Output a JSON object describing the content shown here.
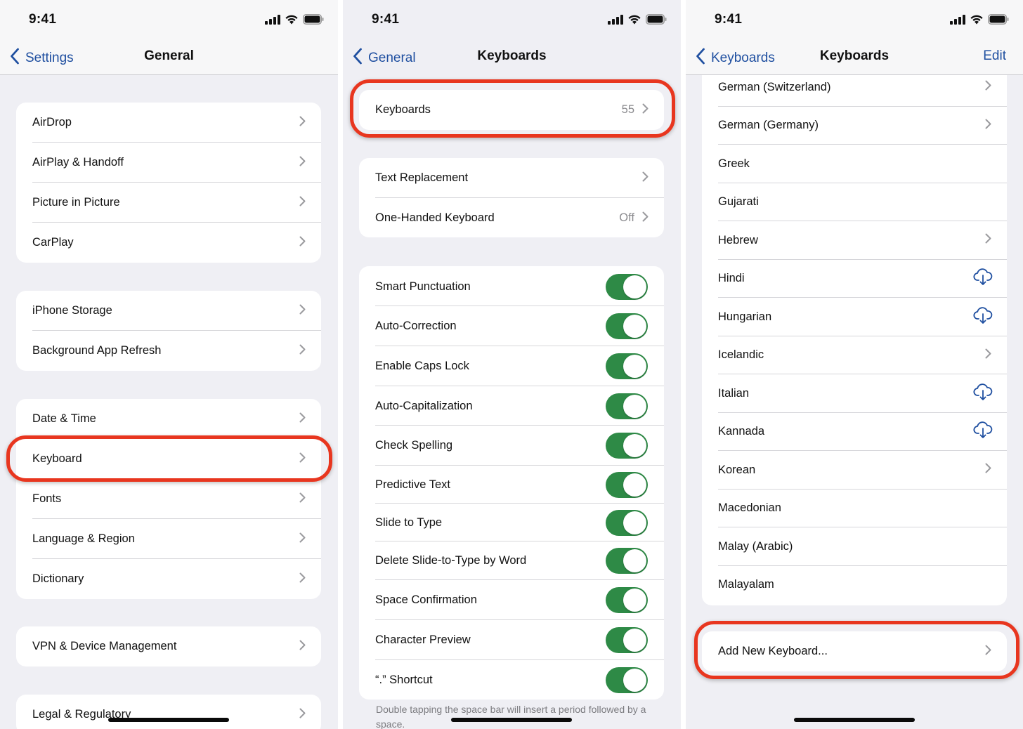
{
  "status_bar": {
    "time": "9:41",
    "icons": [
      "cellular-signal-icon",
      "wifi-icon",
      "battery-icon"
    ]
  },
  "colors": {
    "accent_blue": "#1f4fa0",
    "toggle_green": "#2e8a46",
    "highlight_red": "#e8361f",
    "background": "#efeff4"
  },
  "panel_general": {
    "nav": {
      "back_label": "Settings",
      "title": "General"
    },
    "groups": [
      {
        "items": [
          {
            "label": "AirDrop"
          },
          {
            "label": "AirPlay & Handoff"
          },
          {
            "label": "Picture in Picture"
          },
          {
            "label": "CarPlay"
          }
        ]
      },
      {
        "items": [
          {
            "label": "iPhone Storage"
          },
          {
            "label": "Background App Refresh"
          }
        ]
      },
      {
        "items": [
          {
            "label": "Date & Time"
          },
          {
            "label": "Keyboard",
            "highlighted": true
          },
          {
            "label": "Fonts"
          },
          {
            "label": "Language & Region"
          },
          {
            "label": "Dictionary"
          }
        ]
      },
      {
        "items": [
          {
            "label": "VPN & Device Management"
          }
        ]
      },
      {
        "items": [
          {
            "label": "Legal & Regulatory"
          }
        ]
      }
    ]
  },
  "panel_keyboards": {
    "nav": {
      "back_label": "General",
      "title": "Keyboards"
    },
    "keyboards_row": {
      "label": "Keyboards",
      "value": "55",
      "highlighted": true
    },
    "text_group": [
      {
        "label": "Text Replacement",
        "value": ""
      },
      {
        "label": "One-Handed Keyboard",
        "value": "Off"
      }
    ],
    "toggles": [
      {
        "label": "Smart Punctuation",
        "on": true
      },
      {
        "label": "Auto-Correction",
        "on": true
      },
      {
        "label": "Enable Caps Lock",
        "on": true
      },
      {
        "label": "Auto-Capitalization",
        "on": true
      },
      {
        "label": "Check Spelling",
        "on": true
      },
      {
        "label": "Predictive Text",
        "on": true
      },
      {
        "label": "Slide to Type",
        "on": true
      },
      {
        "label": "Delete Slide-to-Type by Word",
        "on": true
      },
      {
        "label": "Space Confirmation",
        "on": true
      },
      {
        "label": "Character Preview",
        "on": true
      },
      {
        "label": "“.” Shortcut",
        "on": true
      }
    ],
    "footer": "Double tapping the space bar will insert a period followed by a space."
  },
  "panel_keyboard_list": {
    "nav": {
      "back_label": "Keyboards",
      "title": "Keyboards",
      "right_label": "Edit"
    },
    "languages": [
      {
        "label": "German (Switzerland)",
        "accessory": "chevron"
      },
      {
        "label": "German (Germany)",
        "accessory": "chevron"
      },
      {
        "label": "Greek",
        "accessory": "none"
      },
      {
        "label": "Gujarati",
        "accessory": "none"
      },
      {
        "label": "Hebrew",
        "accessory": "chevron"
      },
      {
        "label": "Hindi",
        "accessory": "download"
      },
      {
        "label": "Hungarian",
        "accessory": "download"
      },
      {
        "label": "Icelandic",
        "accessory": "chevron"
      },
      {
        "label": "Italian",
        "accessory": "download"
      },
      {
        "label": "Kannada",
        "accessory": "download"
      },
      {
        "label": "Korean",
        "accessory": "chevron"
      },
      {
        "label": "Macedonian",
        "accessory": "none"
      },
      {
        "label": "Malay (Arabic)",
        "accessory": "none"
      },
      {
        "label": "Malayalam",
        "accessory": "none"
      }
    ],
    "add_row": {
      "label": "Add New Keyboard...",
      "highlighted": true
    }
  }
}
